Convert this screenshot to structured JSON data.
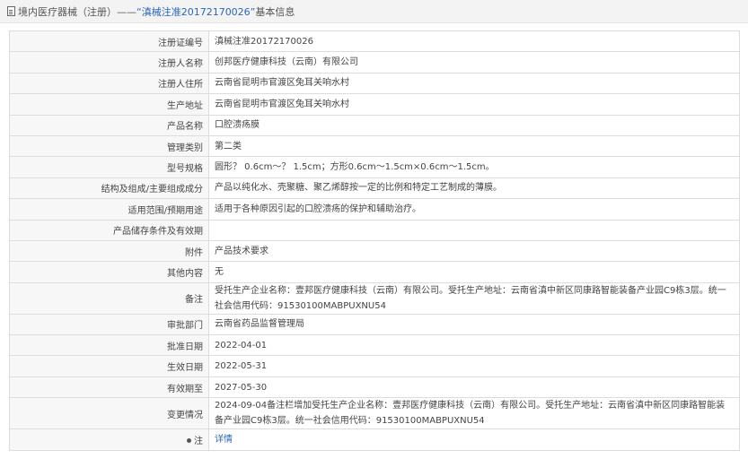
{
  "header": {
    "prefix": "境内医疗器械（注册）——",
    "quoted": "“滇械注准20172170026”",
    "suffix": "基本信息"
  },
  "rows": [
    {
      "label": "注册证编号",
      "value": "滇械注准20172170026"
    },
    {
      "label": "注册人名称",
      "value": "创邦医疗健康科技（云南）有限公司"
    },
    {
      "label": "注册人住所",
      "value": "云南省昆明市官渡区兔耳关响水村"
    },
    {
      "label": "生产地址",
      "value": "云南省昆明市官渡区兔耳关响水村"
    },
    {
      "label": "产品名称",
      "value": "口腔溃疡膜"
    },
    {
      "label": "管理类别",
      "value": "第二类"
    },
    {
      "label": "型号规格",
      "value": "圆形？ 0.6cm～？ 1.5cm；方形0.6cm～1.5cm×0.6cm～1.5cm。"
    },
    {
      "label": "结构及组成/主要组成成分",
      "value": "产品以纯化水、壳聚糖、聚乙烯醇按一定的比例和特定工艺制成的薄膜。"
    },
    {
      "label": "适用范围/预期用途",
      "value": "适用于各种原因引起的口腔溃疡的保护和辅助治疗。"
    },
    {
      "label": "产品储存条件及有效期",
      "value": ""
    },
    {
      "label": "附件",
      "value": "产品技术要求"
    },
    {
      "label": "其他内容",
      "value": "无"
    },
    {
      "label": "备注",
      "value": "受托生产企业名称：壹邦医疗健康科技（云南）有限公司。受托生产地址：云南省滇中新区同康路智能装备产业园C9栋3层。统一社会信用代码：91530100MABPUXNU54"
    },
    {
      "label": "审批部门",
      "value": "云南省药品监督管理局"
    },
    {
      "label": "批准日期",
      "value": "2022-04-01"
    },
    {
      "label": "生效日期",
      "value": "2022-05-31"
    },
    {
      "label": "有效期至",
      "value": "2027-05-30"
    },
    {
      "label": "变更情况",
      "value": "2024-09-04备注栏增加受托生产企业名称：壹邦医疗健康科技（云南）有限公司。受托生产地址：云南省滇中新区同康路智能装备产业园C9栋3层。统一社会信用代码：91530100MABPUXNU54"
    }
  ],
  "note": {
    "label": "注",
    "link": "详情"
  }
}
